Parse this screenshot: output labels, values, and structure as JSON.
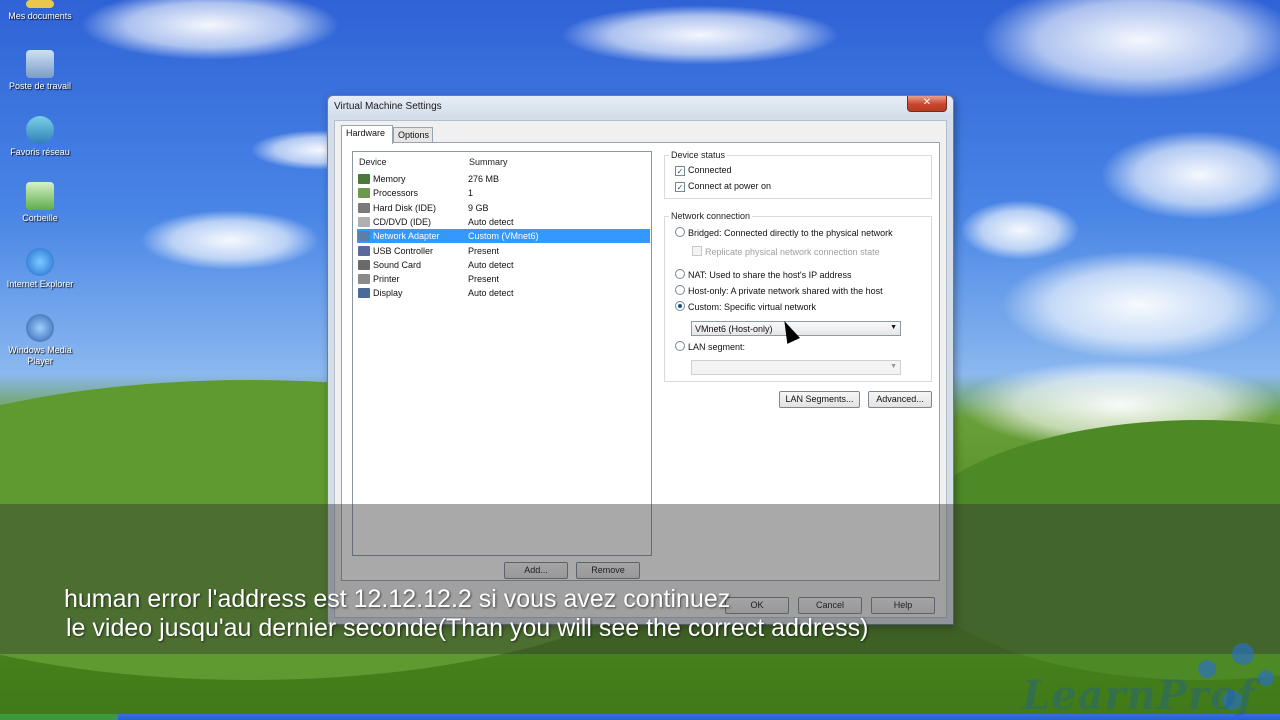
{
  "desktop": {
    "icons": [
      {
        "label": "Mes documents",
        "icon": "folder-icon"
      },
      {
        "label": "Poste de travail",
        "icon": "computer-icon"
      },
      {
        "label": "Favoris réseau",
        "icon": "network-icon"
      },
      {
        "label": "Corbeille",
        "icon": "recycle-bin-icon"
      },
      {
        "label": "Internet Explorer",
        "icon": "internet-explorer-icon"
      },
      {
        "label": "Windows Media Player",
        "icon": "media-player-icon"
      }
    ]
  },
  "window": {
    "title": "Virtual Machine Settings",
    "close_label": "✕",
    "tabs": [
      {
        "label": "Hardware"
      },
      {
        "label": "Options"
      }
    ],
    "device_list": {
      "columns": {
        "device": "Device",
        "summary": "Summary"
      },
      "rows": [
        {
          "device": "Memory",
          "summary": "276 MB",
          "icon": "memory-icon",
          "color": "#4a7a3a"
        },
        {
          "device": "Processors",
          "summary": "1",
          "icon": "processor-icon",
          "color": "#6a9a4a"
        },
        {
          "device": "Hard Disk (IDE)",
          "summary": "9 GB",
          "icon": "hard-disk-icon",
          "color": "#7a7a7a"
        },
        {
          "device": "CD/DVD (IDE)",
          "summary": "Auto detect",
          "icon": "cd-dvd-icon",
          "color": "#b0b0b0"
        },
        {
          "device": "Network Adapter",
          "summary": "Custom (VMnet6)",
          "icon": "network-adapter-icon",
          "color": "#5a7fa8",
          "selected": true
        },
        {
          "device": "USB Controller",
          "summary": "Present",
          "icon": "usb-icon",
          "color": "#5a6a9a"
        },
        {
          "device": "Sound Card",
          "summary": "Auto detect",
          "icon": "sound-card-icon",
          "color": "#6a6a6a"
        },
        {
          "device": "Printer",
          "summary": "Present",
          "icon": "printer-icon",
          "color": "#8a8a8a"
        },
        {
          "device": "Display",
          "summary": "Auto detect",
          "icon": "display-icon",
          "color": "#4a6a9a"
        }
      ]
    },
    "add_label": "Add...",
    "remove_label": "Remove",
    "device_status": {
      "title": "Device status",
      "connected": "Connected",
      "connect_power_on": "Connect at power on"
    },
    "network_connection": {
      "title": "Network connection",
      "bridged": "Bridged: Connected directly to the physical network",
      "replicate": "Replicate physical network connection state",
      "nat": "NAT: Used to share the host's IP address",
      "host_only": "Host-only: A private network shared with the host",
      "custom": "Custom: Specific virtual network",
      "custom_value": "VMnet6 (Host-only)",
      "lan_segment": "LAN segment:",
      "lan_value": ""
    },
    "lan_segments_label": "LAN Segments...",
    "advanced_label": "Advanced...",
    "footer": {
      "ok": "OK",
      "cancel": "Cancel",
      "help": "Help"
    }
  },
  "subtitles": {
    "line1": "human error l'address est 12.12.12.2 si vous avez continuez",
    "line2": " le video jusqu'au dernier seconde(Than you will see the correct address)"
  },
  "watermark": "LearnProf"
}
